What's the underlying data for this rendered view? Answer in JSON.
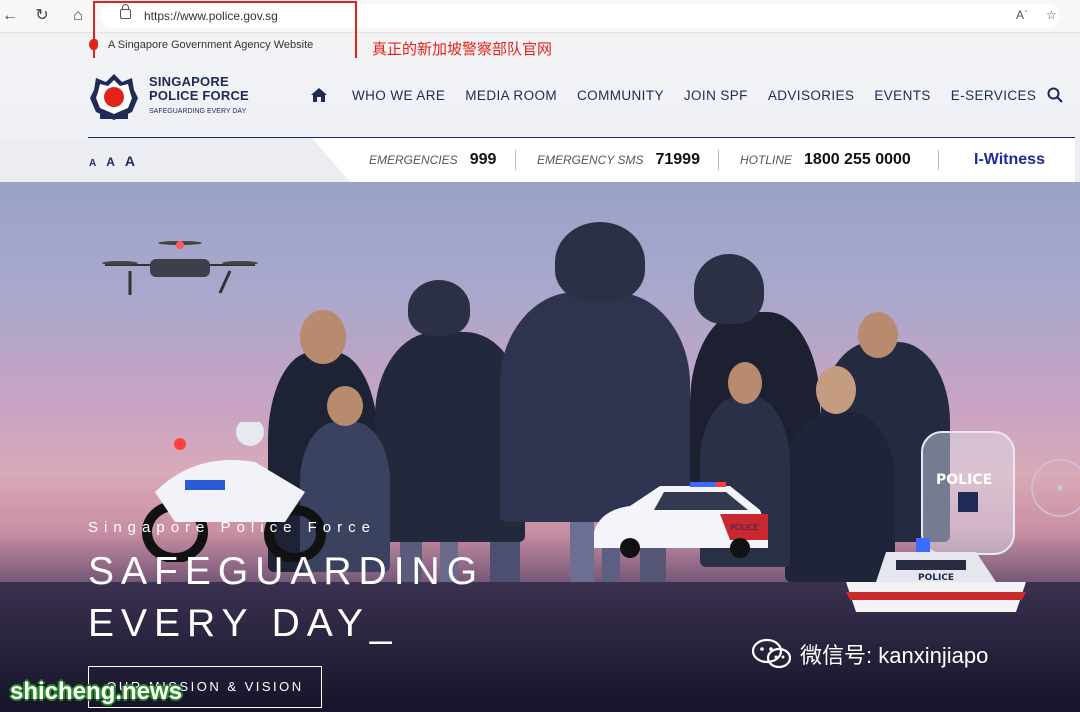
{
  "browser": {
    "url": "https://www.police.gov.sg",
    "back_icon": "back-arrow-icon",
    "reload_icon": "reload-icon",
    "home_icon": "home-icon"
  },
  "gov_banner": {
    "text": "A Singapore Government Agency Website"
  },
  "annotation": {
    "text": "真正的新加坡警察部队官网",
    "color": "#e2231a"
  },
  "logo": {
    "line1": "SINGAPORE",
    "line2": "POLICE FORCE",
    "tagline": "SAFEGUARDING EVERY DAY"
  },
  "nav": {
    "items": [
      "WHO WE ARE",
      "MEDIA ROOM",
      "COMMUNITY",
      "JOIN SPF",
      "ADVISORIES",
      "EVENTS",
      "E-SERVICES"
    ]
  },
  "font_size_controls": [
    "A",
    "A",
    "A"
  ],
  "hotlines": {
    "emergencies_label": "EMERGENCIES",
    "emergencies_value": "999",
    "sms_label": "EMERGENCY SMS",
    "sms_value": "71999",
    "hotline_label": "HOTLINE",
    "hotline_value": "1800 255 0000",
    "iwitness": "I-Witness"
  },
  "hero": {
    "tagline": "Singapore Police Force",
    "title_line1": "SAFEGUARDING",
    "title_line2": "EVERY DAY_",
    "button": "OUR MISSION & VISION",
    "car_label": "POLICE",
    "boat_label": "POLICE",
    "shield_label": "POLICE"
  },
  "overlay": {
    "wechat": "微信号: kanxinjiapo",
    "watermark": "shicheng.news"
  },
  "colors": {
    "brand_navy": "#1f2a55",
    "accent_red": "#e2231a",
    "iwitness_blue": "#1f2a9c"
  }
}
